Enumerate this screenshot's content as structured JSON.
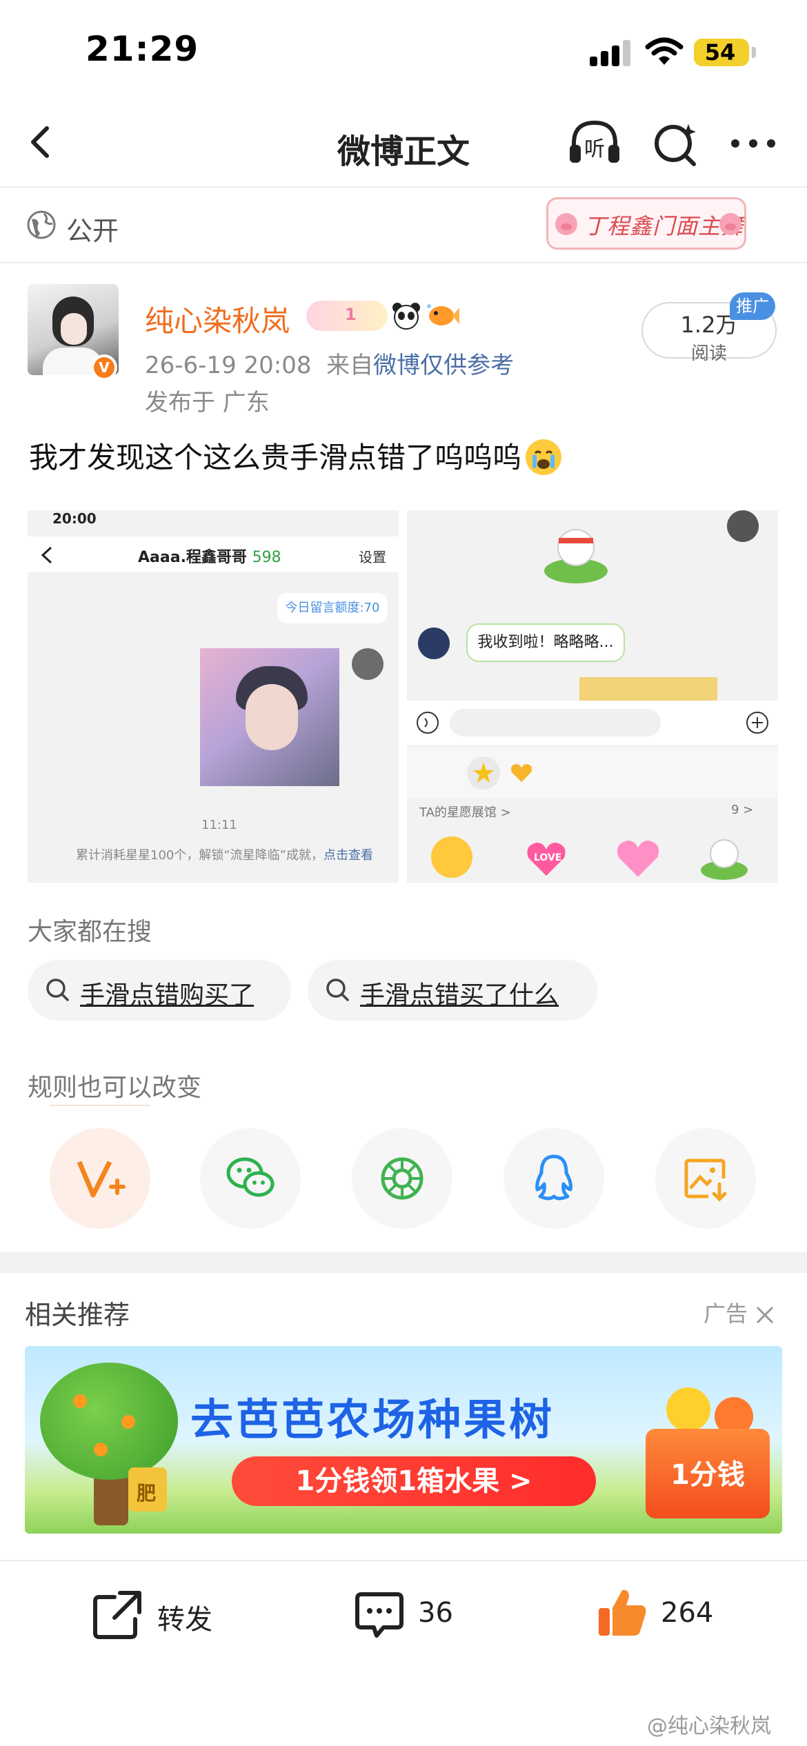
{
  "status_bar": {
    "time": "21:29",
    "battery": "54"
  },
  "nav": {
    "title": "微博正文",
    "listen_label": "听"
  },
  "visibility": {
    "label": "公开",
    "sticker_text": "丁程鑫门面主舞"
  },
  "post": {
    "author": "纯心染秋岚",
    "medal_text": "1",
    "timestamp": "26-6-19 20:08",
    "source_prefix": "来自",
    "source": "微博仅供参考",
    "location": "发布于 广东",
    "reads_count": "1.2万",
    "reads_label": "阅读",
    "promo_badge": "推广",
    "text": "我才发现这个这么贵手滑点错了呜呜呜"
  },
  "screenshot_left": {
    "status": "20:00",
    "title": "Aaaa.程鑫哥哥",
    "title_count": "598",
    "settings": "设置",
    "quota": "今日留言额度:70",
    "time": "11:11",
    "notice": "累计消耗星星100个，解锁“流星降临”成就，",
    "notice_link": "点击查看"
  },
  "screenshot_right": {
    "bubble": "我收到啦！略略略...",
    "gallery_label": "TA的星愿展馆 >",
    "gallery_count": "9 >",
    "heart_text": "LOVE"
  },
  "search": {
    "title": "大家都在搜",
    "chips": [
      {
        "label": "手滑点错购买了"
      },
      {
        "label": "手滑点错买了什么"
      }
    ]
  },
  "share": {
    "title": "规则也可以改变",
    "buttons": [
      "weibo-share",
      "wechat",
      "moments",
      "qq",
      "save-image"
    ]
  },
  "recommend": {
    "title": "相关推荐",
    "ad_label": "广告",
    "ad_headline": "去芭芭农场种果树",
    "ad_pill": "1分钱领1箱水果 >",
    "ad_box": "1分钱",
    "ad_pot": "肥"
  },
  "actions": {
    "repost": "转发",
    "comments": "36",
    "likes": "264"
  },
  "watermark": "@纯心染秋岚"
}
